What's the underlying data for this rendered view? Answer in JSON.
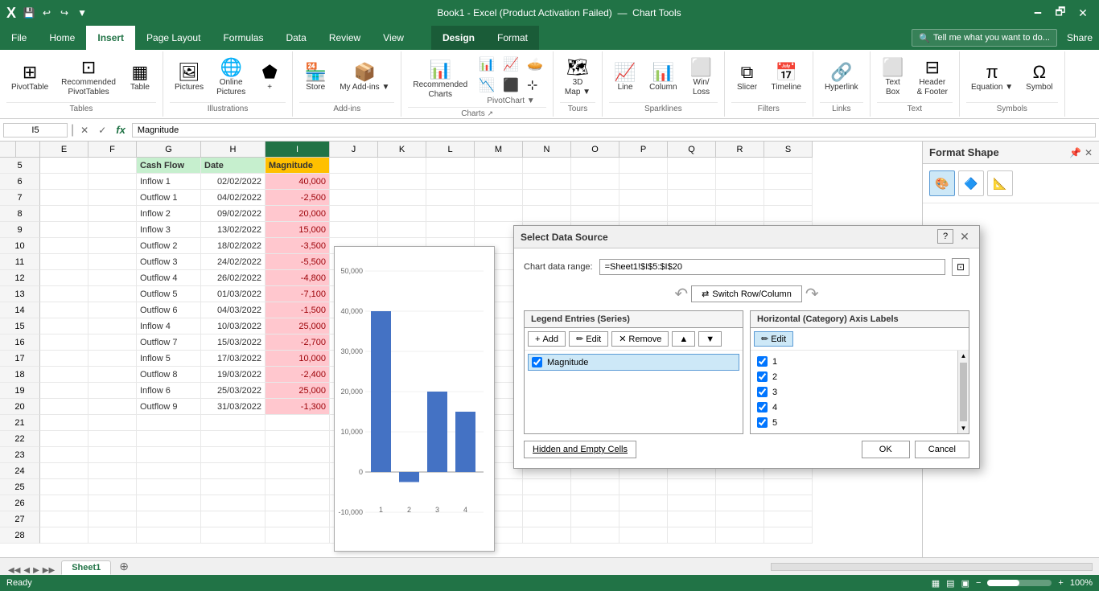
{
  "titlebar": {
    "filename": "Book1 - Excel (Product Activation Failed)",
    "chart_tools": "Chart Tools",
    "min": "🗕",
    "max": "🗗",
    "close": "✕",
    "save_icon": "💾",
    "undo_icon": "↩",
    "redo_icon": "↪",
    "customize": "▼"
  },
  "ribbon": {
    "tabs": [
      "File",
      "Home",
      "Insert",
      "Page Layout",
      "Formulas",
      "Data",
      "Review",
      "View",
      "Design",
      "Format"
    ],
    "active_tab": "Insert",
    "chart_tools_label": "Chart Tools",
    "groups": {
      "tables": {
        "label": "Tables",
        "items": [
          "PivotTable",
          "Recommended PivotTables",
          "Table"
        ]
      },
      "illustrations": {
        "label": "Illustrations",
        "items": [
          "Pictures",
          "Online Pictures",
          "+"
        ]
      },
      "addins": {
        "label": "Add-ins",
        "items": [
          "Store",
          "My Add-ins"
        ]
      },
      "charts": {
        "label": "Charts",
        "items": [
          "Recommended Charts",
          "Column",
          "Line",
          "Pie",
          "Bar",
          "Area",
          "Scatter",
          "More Charts"
        ]
      },
      "tours": {
        "label": "Tours",
        "items": [
          "3D Map"
        ]
      },
      "sparklines": {
        "label": "Sparklines",
        "items": [
          "Line",
          "Column",
          "Win/Loss"
        ]
      },
      "filters": {
        "label": "Filters",
        "items": [
          "Slicer",
          "Timeline"
        ]
      },
      "links": {
        "label": "Links",
        "items": [
          "Hyperlink"
        ]
      },
      "text": {
        "label": "Text",
        "items": [
          "Text Box",
          "Header & Footer"
        ]
      },
      "symbols": {
        "label": "Symbols",
        "items": [
          "Equation",
          "Symbol"
        ]
      }
    }
  },
  "formula_bar": {
    "name_box": "I5",
    "formula_text": "Magnitude",
    "cancel_icon": "✕",
    "confirm_icon": "✓",
    "function_icon": "fx"
  },
  "columns": [
    "E",
    "F",
    "G",
    "H",
    "I",
    "J",
    "K",
    "L",
    "M",
    "N",
    "O",
    "P",
    "Q",
    "R",
    "S"
  ],
  "rows": [
    5,
    6,
    7,
    8,
    9,
    10,
    11,
    12,
    13,
    14,
    15,
    16,
    17,
    18,
    19,
    20,
    21,
    22,
    23,
    24,
    25,
    26,
    27,
    28
  ],
  "cells": {
    "G5": {
      "value": "Cash Flow",
      "style": "header"
    },
    "H5": {
      "value": "Date",
      "style": "header"
    },
    "I5": {
      "value": "Magnitude",
      "style": "header-selected"
    },
    "G6": {
      "value": "Inflow 1"
    },
    "H6": {
      "value": "02/02/2022",
      "align": "right"
    },
    "I6": {
      "value": "40,000",
      "style": "orange",
      "align": "right"
    },
    "G7": {
      "value": "Outflow 1"
    },
    "H7": {
      "value": "04/02/2022",
      "align": "right"
    },
    "I7": {
      "value": "-2,500",
      "style": "orange",
      "align": "right"
    },
    "G8": {
      "value": "Inflow 2"
    },
    "H8": {
      "value": "09/02/2022",
      "align": "right"
    },
    "I8": {
      "value": "20,000",
      "style": "orange",
      "align": "right"
    },
    "G9": {
      "value": "Inflow 3"
    },
    "H9": {
      "value": "13/02/2022",
      "align": "right"
    },
    "I9": {
      "value": "15,000",
      "style": "orange",
      "align": "right"
    },
    "G10": {
      "value": "Outflow 2"
    },
    "H10": {
      "value": "18/02/2022",
      "align": "right"
    },
    "I10": {
      "value": "-3,500",
      "style": "orange",
      "align": "right"
    },
    "G11": {
      "value": "Outflow 3"
    },
    "H11": {
      "value": "24/02/2022",
      "align": "right"
    },
    "I11": {
      "value": "-5,500",
      "style": "orange",
      "align": "right"
    },
    "G12": {
      "value": "Outflow 4"
    },
    "H12": {
      "value": "26/02/2022",
      "align": "right"
    },
    "I12": {
      "value": "-4,800",
      "style": "orange",
      "align": "right"
    },
    "G13": {
      "value": "Outflow 5"
    },
    "H13": {
      "value": "01/03/2022",
      "align": "right"
    },
    "I13": {
      "value": "-7,100",
      "style": "orange",
      "align": "right"
    },
    "G14": {
      "value": "Outflow 6"
    },
    "H14": {
      "value": "04/03/2022",
      "align": "right"
    },
    "I14": {
      "value": "-1,500",
      "style": "orange",
      "align": "right"
    },
    "G15": {
      "value": "Inflow 4"
    },
    "H15": {
      "value": "10/03/2022",
      "align": "right"
    },
    "I15": {
      "value": "25,000",
      "style": "orange",
      "align": "right"
    },
    "G16": {
      "value": "Outflow 7"
    },
    "H16": {
      "value": "15/03/2022",
      "align": "right"
    },
    "I16": {
      "value": "-2,700",
      "style": "orange",
      "align": "right"
    },
    "G17": {
      "value": "Inflow 5"
    },
    "H17": {
      "value": "17/03/2022",
      "align": "right"
    },
    "I17": {
      "value": "10,000",
      "style": "orange",
      "align": "right"
    },
    "G18": {
      "value": "Outflow 8"
    },
    "H18": {
      "value": "19/03/2022",
      "align": "right"
    },
    "I18": {
      "value": "-2,400",
      "style": "orange",
      "align": "right"
    },
    "G19": {
      "value": "Inflow 6"
    },
    "H19": {
      "value": "25/03/2022",
      "align": "right"
    },
    "I19": {
      "value": "25,000",
      "style": "orange",
      "align": "right"
    },
    "G20": {
      "value": "Outflow 9"
    },
    "H20": {
      "value": "31/03/2022",
      "align": "right"
    },
    "I20": {
      "value": "-1,300",
      "style": "orange",
      "align": "right"
    }
  },
  "dialog": {
    "title": "Select Data Source",
    "help_icon": "?",
    "close_icon": "✕",
    "chart_data_range_label": "Chart data range:",
    "chart_data_range_value": "=Sheet1!$I$5:$I$20",
    "switch_row_column_label": "Switch Row/Column",
    "legend_entries_title": "Legend Entries (Series)",
    "horizontal_axis_title": "Horizontal (Category) Axis Labels",
    "add_btn": "Add",
    "edit_btn": "Edit",
    "remove_btn": "Remove",
    "move_up_icon": "▲",
    "move_down_icon": "▼",
    "axis_edit_btn": "Edit",
    "series": [
      {
        "checked": true,
        "name": "Magnitude",
        "selected": true
      }
    ],
    "axis_labels": [
      {
        "checked": true,
        "value": "1"
      },
      {
        "checked": true,
        "value": "2"
      },
      {
        "checked": true,
        "value": "3"
      },
      {
        "checked": true,
        "value": "4"
      },
      {
        "checked": true,
        "value": "5"
      }
    ],
    "hidden_empty_cells_btn": "Hidden and Empty Cells",
    "ok_btn": "OK",
    "cancel_btn": "Cancel"
  },
  "format_panel": {
    "title": "Format Shape",
    "close_icon": "✕",
    "pin_icon": "📌",
    "icons": [
      "🎨",
      "🔷",
      "📊"
    ]
  },
  "sheet_tabs": [
    "Sheet1"
  ],
  "status": {
    "ready": "Ready",
    "page_btns": [
      "▦",
      "▤",
      "▣"
    ],
    "zoom_minus": "−",
    "zoom_plus": "+",
    "zoom": "100%"
  }
}
